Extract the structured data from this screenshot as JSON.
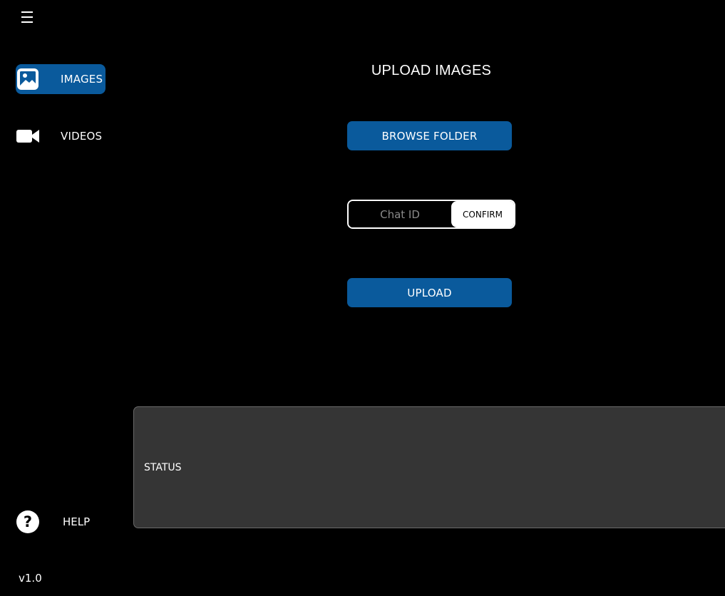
{
  "sidebar": {
    "menu_icon": "hamburger-menu-icon",
    "items": [
      {
        "label": "IMAGES",
        "icon": "image-icon",
        "active": true
      },
      {
        "label": "VIDEOS",
        "icon": "video-camera-icon",
        "active": false
      }
    ],
    "help": {
      "label": "HELP",
      "icon": "question-circle-icon"
    },
    "version": "v1.0"
  },
  "main": {
    "title": "UPLOAD IMAGES",
    "browse_label": "BROWSE FOLDER",
    "chat_id": {
      "placeholder": "Chat ID",
      "value": "",
      "confirm_label": "CONFIRM"
    },
    "upload_label": "UPLOAD",
    "status_label": "STATUS"
  },
  "colors": {
    "background": "#000000",
    "accent": "#0a5a9c",
    "status_panel": "#353535",
    "text": "#ffffff",
    "placeholder": "#8a8a8a"
  }
}
